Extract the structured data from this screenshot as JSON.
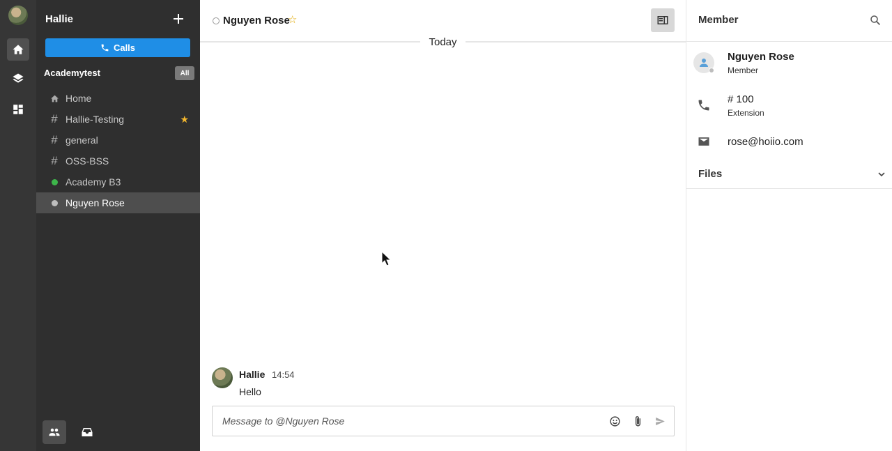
{
  "rail": {
    "icons": [
      "home-icon",
      "layers-icon",
      "dashboard-icon"
    ]
  },
  "sidebar": {
    "user_name": "Hallie",
    "calls_label": "Calls",
    "workspace": "Academytest",
    "filter_badge": "All",
    "channels": [
      {
        "label": "Home",
        "type": "home"
      },
      {
        "label": "Hallie-Testing",
        "type": "channel",
        "favorite": true
      },
      {
        "label": "general",
        "type": "channel"
      },
      {
        "label": "OSS-BSS",
        "type": "channel"
      },
      {
        "label": "Academy B3",
        "type": "dm",
        "status": "online"
      },
      {
        "label": "Nguyen Rose",
        "type": "dm",
        "status": "offline",
        "active": true
      }
    ]
  },
  "chat": {
    "title": "Nguyen Rose",
    "date_separator": "Today",
    "messages": [
      {
        "author": "Hallie",
        "time": "14:54",
        "text": "Hello"
      }
    ],
    "composer_placeholder": "Message to @Nguyen Rose"
  },
  "panel": {
    "title": "Member",
    "member_name": "Nguyen Rose",
    "member_role": "Member",
    "extension_value": "# 100",
    "extension_label": "Extension",
    "email": "rose@hoiio.com",
    "files_label": "Files"
  },
  "colors": {
    "accent": "#1f8ee6",
    "rail_bg": "#363636",
    "sidebar_bg": "#2f2f2f",
    "online": "#3db54a",
    "favorite": "#f5b82e"
  }
}
